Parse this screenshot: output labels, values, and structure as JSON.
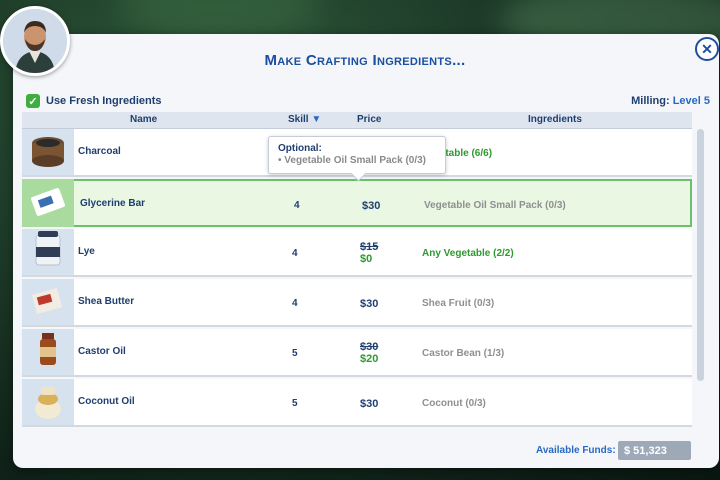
{
  "dialog": {
    "title": "Make Crafting Ingredients...",
    "use_fresh_label": "Use Fresh Ingredients",
    "milling_label": "Milling:",
    "milling_level": "Level 5"
  },
  "columns": {
    "name": "Name",
    "skill": "Skill",
    "price": "Price",
    "ingredients": "Ingredients"
  },
  "tooltip": {
    "title": "Optional:",
    "item": "• Vegetable Oil Small Pack (0/3)"
  },
  "rows": [
    {
      "name": "Charcoal",
      "skill": "",
      "price": "",
      "old_price": "",
      "ingredients": "Vegetable (6/6)",
      "ing_status": "ok"
    },
    {
      "name": "Glycerine Bar",
      "skill": "4",
      "price": "$30",
      "old_price": "",
      "ingredients": "Vegetable Oil Small Pack (0/3)",
      "ing_status": "missing"
    },
    {
      "name": "Lye",
      "skill": "4",
      "price": "$0",
      "old_price": "$15",
      "ingredients": "Any Vegetable (2/2)",
      "ing_status": "ok"
    },
    {
      "name": "Shea Butter",
      "skill": "4",
      "price": "$30",
      "old_price": "",
      "ingredients": "Shea Fruit (0/3)",
      "ing_status": "missing"
    },
    {
      "name": "Castor Oil",
      "skill": "5",
      "price": "$20",
      "old_price": "$30",
      "ingredients": "Castor Bean (1/3)",
      "ing_status": "missing"
    },
    {
      "name": "Coconut Oil",
      "skill": "5",
      "price": "$30",
      "old_price": "",
      "ingredients": "Coconut (0/3)",
      "ing_status": "missing"
    }
  ],
  "funds": {
    "label": "Available Funds:",
    "value": "$ 51,323"
  },
  "colors": {
    "accent": "#1a4ea0",
    "ok": "#2e9a2e",
    "selected_border": "#6cc06a"
  }
}
